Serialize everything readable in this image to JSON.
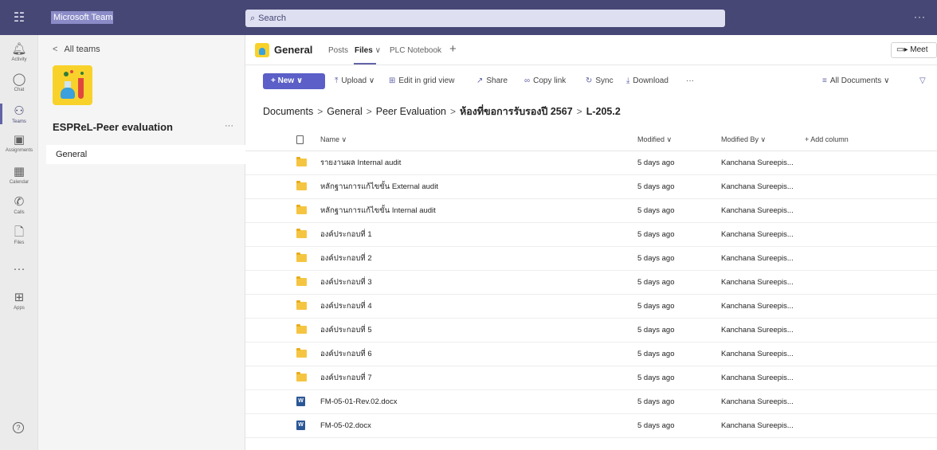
{
  "titlebar": {
    "app_name": "Microsoft Teams",
    "search_placeholder": "Search",
    "more": "···"
  },
  "rail": {
    "items": [
      {
        "label": "Activity",
        "icon": "bell-icon"
      },
      {
        "label": "Chat",
        "icon": "chat-icon"
      },
      {
        "label": "Teams",
        "icon": "teams-icon"
      },
      {
        "label": "Assignments",
        "icon": "assignments-icon"
      },
      {
        "label": "Calendar",
        "icon": "calendar-icon"
      },
      {
        "label": "Calls",
        "icon": "phone-icon"
      },
      {
        "label": "Files",
        "icon": "file-icon"
      },
      {
        "label": "···",
        "icon": "more-icon"
      },
      {
        "label": "Apps",
        "icon": "apps-icon"
      }
    ],
    "help": "?"
  },
  "team_panel": {
    "back_label": "All teams",
    "team_name": "ESPReL-Peer evaluation",
    "more": "···",
    "channels": [
      "General"
    ]
  },
  "channel_header": {
    "title": "General",
    "tabs": [
      "Posts",
      "Files",
      "PLC Notebook"
    ],
    "active_tab": "Files",
    "add": "+",
    "meet_label": "Meet"
  },
  "toolbar": {
    "new_label": "+ New",
    "upload": "Upload",
    "edit_grid": "Edit in grid view",
    "share": "Share",
    "copy_link": "Copy link",
    "sync": "Sync",
    "download": "Download",
    "more": "···",
    "view": "All Documents",
    "filter_icon": "filter-icon"
  },
  "breadcrumb": [
    "Documents",
    "General",
    "Peer Evaluation",
    "ห้องที่ขอการรับรองปี 2567",
    "L-205.2"
  ],
  "file_table": {
    "columns": {
      "name": "Name",
      "modified": "Modified",
      "modified_by": "Modified By",
      "add_column": "+ Add column"
    },
    "rows": [
      {
        "type": "folder",
        "name": "รายงานผล Internal audit",
        "modified": "5 days ago",
        "modified_by": "Kanchana Sureepis..."
      },
      {
        "type": "folder",
        "name": "หลักฐานการแก้ไขขั้น External audit",
        "modified": "5 days ago",
        "modified_by": "Kanchana Sureepis..."
      },
      {
        "type": "folder",
        "name": "หลักฐานการแก้ไขขั้น Internal audit",
        "modified": "5 days ago",
        "modified_by": "Kanchana Sureepis..."
      },
      {
        "type": "folder",
        "name": "องค์ประกอบที่ 1",
        "modified": "5 days ago",
        "modified_by": "Kanchana Sureepis..."
      },
      {
        "type": "folder",
        "name": "องค์ประกอบที่ 2",
        "modified": "5 days ago",
        "modified_by": "Kanchana Sureepis..."
      },
      {
        "type": "folder",
        "name": "องค์ประกอบที่ 3",
        "modified": "5 days ago",
        "modified_by": "Kanchana Sureepis..."
      },
      {
        "type": "folder",
        "name": "องค์ประกอบที่ 4",
        "modified": "5 days ago",
        "modified_by": "Kanchana Sureepis..."
      },
      {
        "type": "folder",
        "name": "องค์ประกอบที่ 5",
        "modified": "5 days ago",
        "modified_by": "Kanchana Sureepis..."
      },
      {
        "type": "folder",
        "name": "องค์ประกอบที่ 6",
        "modified": "5 days ago",
        "modified_by": "Kanchana Sureepis..."
      },
      {
        "type": "folder",
        "name": "องค์ประกอบที่ 7",
        "modified": "5 days ago",
        "modified_by": "Kanchana Sureepis..."
      },
      {
        "type": "docx",
        "name": "FM-05-01-Rev.02.docx",
        "modified": "5 days ago",
        "modified_by": "Kanchana Sureepis..."
      },
      {
        "type": "docx",
        "name": "FM-05-02.docx",
        "modified": "5 days ago",
        "modified_by": "Kanchana Sureepis..."
      }
    ]
  },
  "colors": {
    "titlebar": "#464775",
    "accent": "#5b5fc7",
    "folder": "#f5c542",
    "word": "#2b5797"
  }
}
